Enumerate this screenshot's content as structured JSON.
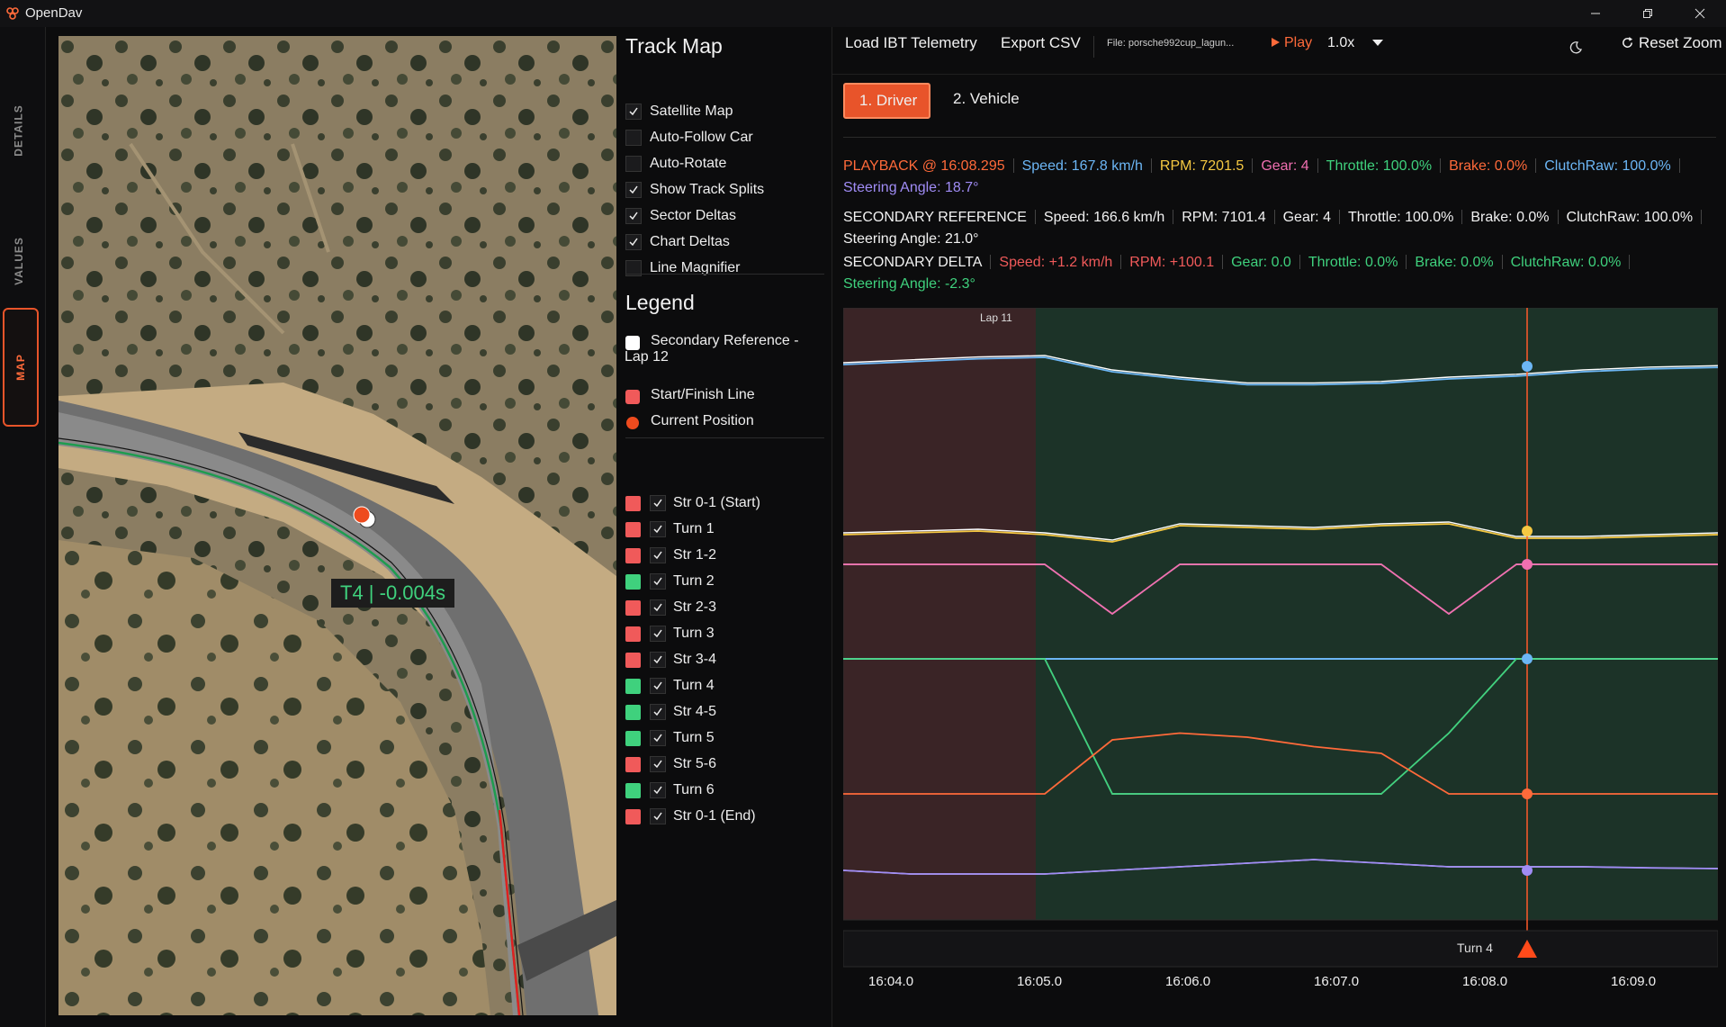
{
  "app": {
    "title": "OpenDav"
  },
  "sidenav": {
    "tabs": [
      "DETAILS",
      "VALUES",
      "MAP"
    ],
    "active": "MAP"
  },
  "map": {
    "split_label": "T4 | -0.004s"
  },
  "panel": {
    "title": "Track Map",
    "options": [
      {
        "label": "Satellite Map",
        "checked": true
      },
      {
        "label": "Auto-Follow Car",
        "checked": false
      },
      {
        "label": "Auto-Rotate",
        "checked": false
      },
      {
        "label": "Show Track Splits",
        "checked": true
      },
      {
        "label": "Sector Deltas",
        "checked": true
      },
      {
        "label": "Chart Deltas",
        "checked": true
      },
      {
        "label": "Line Magnifier",
        "checked": false
      }
    ],
    "legend_title": "Legend",
    "legend": [
      {
        "label_1": "Secondary Reference -",
        "label_2": "Lap 12",
        "color": "#ffffff",
        "shape": "square"
      },
      {
        "label_1": "Start/Finish Line",
        "label_2": "",
        "color": "#f05a5a",
        "shape": "square"
      },
      {
        "label_1": "Current Position",
        "label_2": "",
        "color": "#ee4b1e",
        "shape": "circle"
      }
    ],
    "splits": [
      {
        "label": "Str 0-1 (Start)",
        "color": "#f05a5a",
        "checked": true
      },
      {
        "label": "Turn 1",
        "color": "#f05a5a",
        "checked": true
      },
      {
        "label": "Str 1-2",
        "color": "#f05a5a",
        "checked": true
      },
      {
        "label": "Turn 2",
        "color": "#3fd17d",
        "checked": true
      },
      {
        "label": "Str 2-3",
        "color": "#f05a5a",
        "checked": true
      },
      {
        "label": "Turn 3",
        "color": "#f05a5a",
        "checked": true
      },
      {
        "label": "Str 3-4",
        "color": "#f05a5a",
        "checked": true
      },
      {
        "label": "Turn 4",
        "color": "#3fd17d",
        "checked": true
      },
      {
        "label": "Str 4-5",
        "color": "#3fd17d",
        "checked": true
      },
      {
        "label": "Turn 5",
        "color": "#3fd17d",
        "checked": true
      },
      {
        "label": "Str 5-6",
        "color": "#f05a5a",
        "checked": true
      },
      {
        "label": "Turn 6",
        "color": "#3fd17d",
        "checked": true
      },
      {
        "label": "Str 0-1 (End)",
        "color": "#f05a5a",
        "checked": true
      }
    ]
  },
  "toolbar": {
    "load": "Load IBT Telemetry",
    "export": "Export CSV",
    "file": "File: porsche992cup_lagun...",
    "play": "Play",
    "speed": "1.0x",
    "reset": "Reset Zoom"
  },
  "tabs": [
    "1. Driver",
    "2. Vehicle"
  ],
  "readouts": {
    "playback": {
      "items": [
        {
          "text": "PLAYBACK @ 16:08.295",
          "color": "#ff6a3a"
        },
        {
          "text": "Speed: 167.8 km/h",
          "color": "#6cb6f5"
        },
        {
          "text": "RPM: 7201.5",
          "color": "#f5c842"
        },
        {
          "text": "Gear: 4",
          "color": "#f06fb0"
        },
        {
          "text": "Throttle: 100.0%",
          "color": "#3fd17d"
        },
        {
          "text": "Brake: 0.0%",
          "color": "#ff6a3a"
        },
        {
          "text": "ClutchRaw: 100.0%",
          "color": "#6cb6f5"
        },
        {
          "text": "Steering Angle: 18.7°",
          "color": "#a08cf5"
        }
      ]
    },
    "reference": {
      "items": [
        {
          "text": "SECONDARY REFERENCE",
          "color": "#f2f2f2"
        },
        {
          "text": "Speed: 166.6 km/h",
          "color": "#f2f2f2"
        },
        {
          "text": "RPM: 7101.4",
          "color": "#f2f2f2"
        },
        {
          "text": "Gear: 4",
          "color": "#f2f2f2"
        },
        {
          "text": "Throttle: 100.0%",
          "color": "#f2f2f2"
        },
        {
          "text": "Brake: 0.0%",
          "color": "#f2f2f2"
        },
        {
          "text": "ClutchRaw: 100.0%",
          "color": "#f2f2f2"
        },
        {
          "text": "Steering Angle: 21.0°",
          "color": "#f2f2f2"
        }
      ]
    },
    "delta": {
      "items": [
        {
          "text": "SECONDARY DELTA",
          "color": "#f2f2f2"
        },
        {
          "text": "Speed: +1.2 km/h",
          "color": "#f05a5a"
        },
        {
          "text": "RPM: +100.1",
          "color": "#f05a5a"
        },
        {
          "text": "Gear: 0.0",
          "color": "#3fd17d"
        },
        {
          "text": "Throttle: 0.0%",
          "color": "#3fd17d"
        },
        {
          "text": "Brake: 0.0%",
          "color": "#3fd17d"
        },
        {
          "text": "ClutchRaw: 0.0%",
          "color": "#3fd17d"
        },
        {
          "text": "Steering Angle: -2.3°",
          "color": "#3fd17d"
        }
      ]
    }
  },
  "chart_data": {
    "type": "line",
    "lap_label": "Lap 11",
    "xlim": [
      16.037,
      16.093
    ],
    "x_ticks": [
      "16:04.0",
      "16:05.0",
      "16:06.0",
      "16:07.0",
      "16:08.0",
      "16:09.0"
    ],
    "cursor_time": "16:08.295",
    "marker_label": "Turn 4",
    "lap_region_start": "16:05.0",
    "series": [
      {
        "name": "Speed",
        "color": "#6cb6f5",
        "cursor_value": "167.8 km/h",
        "values": [
          0.9,
          0.92,
          0.94,
          0.95,
          0.85,
          0.8,
          0.76,
          0.76,
          0.77,
          0.8,
          0.82,
          0.85,
          0.87,
          0.88
        ]
      },
      {
        "name": "RPM",
        "color": "#f5c842",
        "cursor_value": "7201.5",
        "values": [
          0.9,
          0.91,
          0.92,
          0.9,
          0.86,
          0.95,
          0.94,
          0.93,
          0.95,
          0.96,
          0.88,
          0.88,
          0.89,
          0.9
        ]
      },
      {
        "name": "Gear",
        "color": "#f06fb0",
        "cursor_value": "4",
        "values": [
          4,
          4,
          4,
          4,
          3,
          4,
          4,
          4,
          4,
          3,
          4,
          4,
          4,
          4
        ]
      },
      {
        "name": "Throttle",
        "color": "#3fd17d",
        "cursor_value": "100.0%",
        "values": [
          100,
          100,
          100,
          100,
          0,
          0,
          0,
          0,
          0,
          45,
          100,
          100,
          100,
          100
        ]
      },
      {
        "name": "Brake",
        "color": "#ff6a3a",
        "cursor_value": "0.0%",
        "values": [
          0,
          0,
          0,
          0,
          40,
          45,
          42,
          35,
          30,
          0,
          0,
          0,
          0,
          0
        ]
      },
      {
        "name": "ClutchRaw",
        "color": "#6cb6f5",
        "cursor_value": "100.0%",
        "values": [
          100,
          100,
          100,
          100,
          100,
          100,
          100,
          100,
          100,
          100,
          100,
          100,
          100,
          100
        ]
      },
      {
        "name": "Steering Angle",
        "color": "#a08cf5",
        "cursor_value": "18.7°",
        "values": [
          18,
          17,
          17,
          17,
          18,
          19,
          20,
          21,
          20,
          19,
          19,
          19,
          18.7,
          18.5
        ]
      }
    ]
  }
}
